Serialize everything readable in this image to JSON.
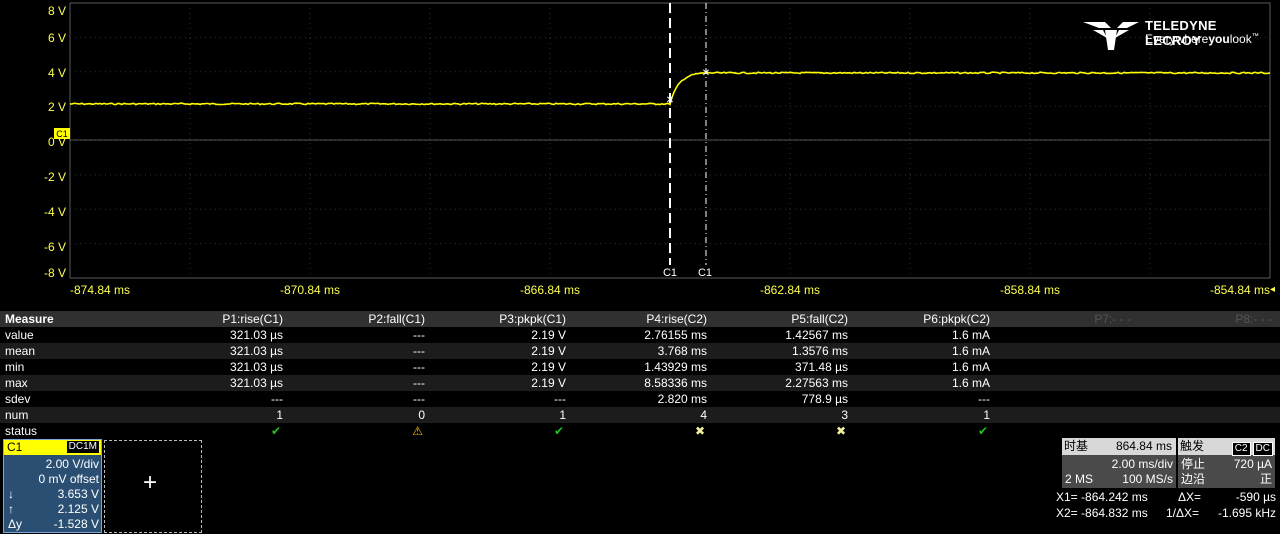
{
  "brand": {
    "name": "TELEDYNE LECROY",
    "tagline_pre": "Everywhere",
    "tagline_bold": "you",
    "tagline_post": "look",
    "tm": "™"
  },
  "colors": {
    "trace": "#ffff00",
    "grid": "#3a3a3a",
    "axis_label": "#ffff4d",
    "panel_blue": "#2a4f73"
  },
  "y_axis": [
    "8 V",
    "6 V",
    "4 V",
    "2 V",
    "0 V",
    "-2 V",
    "-4 V",
    "-6 V",
    "-8 V"
  ],
  "x_axis": [
    "-874.84 ms",
    "-870.84 ms",
    "-866.84 ms",
    "-862.84 ms",
    "-858.84 ms",
    "-854.84 ms"
  ],
  "channel_marker": "C1",
  "cursor_labels": [
    "C1",
    "C1"
  ],
  "measure": {
    "title": "Measure",
    "columns": [
      "P1:rise(C1)",
      "P2:fall(C1)",
      "P3:pkpk(C1)",
      "P4:rise(C2)",
      "P5:fall(C2)",
      "P6:pkpk(C2)",
      "P7:- - -",
      "P8:- - -"
    ],
    "rows": [
      {
        "label": "value",
        "cells": [
          "321.03 µs",
          "---",
          "2.19 V",
          "2.76155 ms",
          "1.42567 ms",
          "1.6 mA",
          "",
          ""
        ]
      },
      {
        "label": "mean",
        "cells": [
          "321.03 µs",
          "---",
          "2.19 V",
          "3.768 ms",
          "1.3576 ms",
          "1.6 mA",
          "",
          ""
        ]
      },
      {
        "label": "min",
        "cells": [
          "321.03 µs",
          "---",
          "2.19 V",
          "1.43929 ms",
          "371.48 µs",
          "1.6 mA",
          "",
          ""
        ]
      },
      {
        "label": "max",
        "cells": [
          "321.03 µs",
          "---",
          "2.19 V",
          "8.58336 ms",
          "2.27563 ms",
          "1.6 mA",
          "",
          ""
        ]
      },
      {
        "label": "sdev",
        "cells": [
          "---",
          "---",
          "---",
          "2.820 ms",
          "778.9 µs",
          "---",
          "",
          ""
        ]
      },
      {
        "label": "num",
        "cells": [
          "1",
          "0",
          "1",
          "4",
          "3",
          "1",
          "",
          ""
        ]
      },
      {
        "label": "status",
        "cells": [
          "✔",
          "⚠",
          "✔",
          "✖",
          "✖",
          "✔",
          "",
          ""
        ]
      }
    ],
    "status_colors": [
      "#22c022",
      "#f0c000",
      "#22c022",
      "#f0f0a0",
      "#f0f0a0",
      "#22c022",
      "",
      ""
    ]
  },
  "c1_panel": {
    "channel": "C1",
    "coupling": "DC1M",
    "vdiv": "2.00 V/div",
    "offset": "0 mV offset",
    "down_sym": "↓",
    "down_val": "3.653 V",
    "up_sym": "↑",
    "up_val": "2.125 V",
    "dy_sym": "Δy",
    "dy_val": "-1.528 V"
  },
  "add_button": "+",
  "timebase": {
    "label": "时基",
    "delay": "864.84 ms",
    "tdiv": "2.00 ms/div",
    "points": "2 MS",
    "rate": "100 MS/s"
  },
  "trigger": {
    "label": "触发",
    "src": "C2",
    "coupling": "DC",
    "mode_label": "停止",
    "level": "720 µA",
    "edge_label": "边沿",
    "slope": "正"
  },
  "cursors": {
    "x1_label": "X1=",
    "x1": "-864.242 ms",
    "dx_label": "ΔX=",
    "dx": "-590 µs",
    "x2_label": "X2=",
    "x2": "-864.832 ms",
    "inv_label": "1/ΔX=",
    "inv": "-1.695 kHz"
  }
}
